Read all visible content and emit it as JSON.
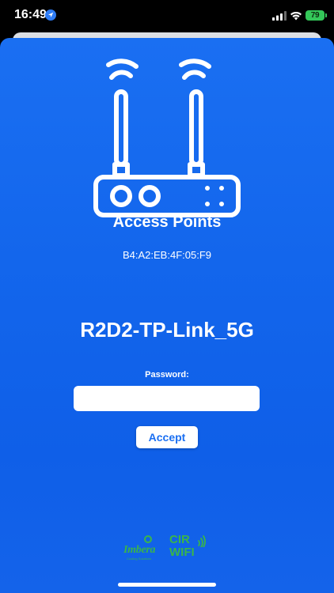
{
  "status_bar": {
    "time": "16:49",
    "battery": "79"
  },
  "access_point": {
    "title": "Access Points",
    "mac": "B4:A2:EB:4F:05:F9",
    "ssid": "R2D2-TP-Link_5G"
  },
  "form": {
    "password_label": "Password:",
    "password_value": "",
    "accept_label": "Accept"
  },
  "footer": {
    "logo_imbera": "Imbera",
    "logo_imbera_sub": "Cooling Solutions",
    "logo_cir": "CIR",
    "logo_wifi": "WIFI"
  },
  "colors": {
    "card_blue": "#1366ec",
    "accent_white": "#ffffff",
    "accept_text": "#1a6ff2",
    "battery_green": "#34c759",
    "logo_green": "#3ab54a"
  },
  "icons": {
    "router": "router-icon",
    "location": "location-arrow-icon",
    "signal": "cellular-signal-icon",
    "wifi": "wifi-icon",
    "battery": "battery-icon"
  }
}
